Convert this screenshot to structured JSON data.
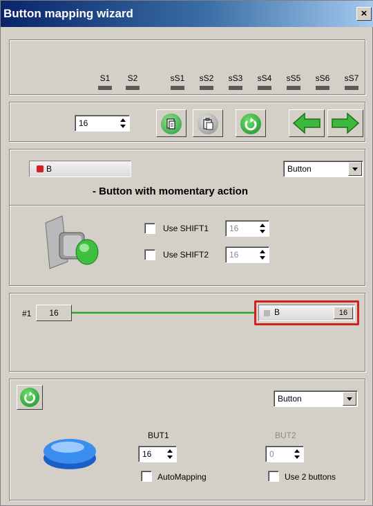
{
  "window": {
    "title": "Button mapping wizard",
    "close_glyph": "×"
  },
  "shifts": [
    "S1",
    "S2",
    "sS1",
    "sS2",
    "sS3",
    "sS4",
    "sS5",
    "sS6",
    "sS7"
  ],
  "toolbar": {
    "spin_value": "16",
    "icons": [
      "copy-icon",
      "paste-icon",
      "refresh-icon",
      "arrow-left-icon",
      "arrow-right-icon"
    ]
  },
  "button_config": {
    "name": "B",
    "type_select": "Button",
    "description": "- Button with momentary action",
    "shift1_label": "Use SHIFT1",
    "shift1_value": "16",
    "shift2_label": "Use SHIFT2",
    "shift2_value": "16"
  },
  "mapping": {
    "index_label": "#1",
    "input_value": "16",
    "target_name": "B",
    "target_value": "16",
    "colors": {
      "line": "#2e9e2e",
      "highlight": "#d42020"
    }
  },
  "bottom": {
    "type_select": "Button",
    "but1_label": "BUT1",
    "but1_value": "16",
    "but2_label": "BUT2",
    "but2_value": "0",
    "automapping_label": "AutoMapping",
    "use2_label": "Use 2 buttons"
  }
}
